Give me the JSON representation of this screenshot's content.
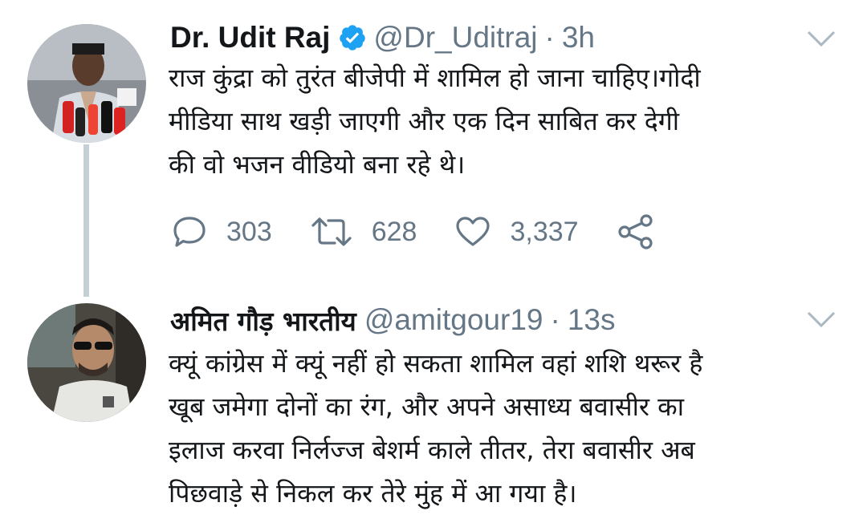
{
  "tweets": [
    {
      "author_name": "Dr. Udit Raj",
      "verified": true,
      "handle": "@Dr_Uditraj",
      "separator": "·",
      "time": "3h",
      "text_lines": [
        "राज कुंद्रा को तुरंत बीजेपी में शामिल हो जाना चाहिए।गोदी",
        "मीडिया साथ खड़ी जाएगी और एक दिन साबित कर देगी",
        "की वो भजन वीडियो बना रहे थे।"
      ],
      "actions": {
        "replies": "303",
        "retweets": "628",
        "likes": "3,337"
      },
      "icons": [
        "reply-icon",
        "retweet-icon",
        "like-icon",
        "share-icon"
      ]
    },
    {
      "author_name": "अमित गौड़ भारतीय",
      "verified": false,
      "handle": "@amitgour19",
      "separator": "·",
      "time": "13s",
      "text_lines": [
        "क्यूं कांग्रेस में क्यूं नहीं हो सकता शामिल वहां शशि थरूर है",
        "खूब जमेगा दोनों का रंग, और अपने असाध्य बवासीर का",
        "इलाज करवा निर्लज्ज बेशर्म काले तीतर, तेरा बवासीर अब",
        "पिछवाड़े से निकल कर तेरे मुंह में आ गया है।"
      ]
    }
  ],
  "colors": {
    "text": "#14171a",
    "secondary": "#657786",
    "verified": "#1da1f2",
    "thread_line": "#c4cfd6"
  }
}
